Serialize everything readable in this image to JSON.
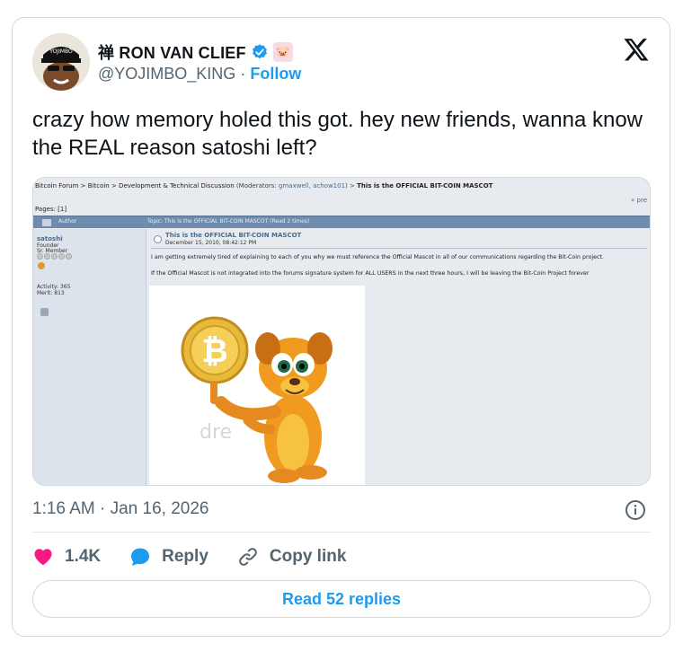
{
  "header": {
    "display_name": "禅 RON VAN CLIEF",
    "emoji_badge": "🐷",
    "handle": "@YOJIMBO_KING",
    "separator": "·",
    "follow_label": "Follow",
    "avatar_cap_text": "YOJIMBO"
  },
  "tweet": {
    "text": "crazy how memory holed this got. hey new friends, wanna know the REAL reason satoshi left?"
  },
  "media": {
    "breadcrumb": "Bitcoin Forum > Bitcoin > Development & Technical Discussion",
    "moderators_label": "(Moderators: ",
    "moderators": "gmaxwell, achow101",
    "moderators_end": ") > ",
    "topic_bold": "This is the OFFICIAL BIT-COIN MASCOT",
    "prev": "« pre",
    "pages": "Pages: [1]",
    "author_header": "Author",
    "topic_header": "Topic: This is the OFFICIAL BIT-COIN MASCOT  (Read 2 times)",
    "username": "satoshi",
    "rank1": "Founder",
    "rank2": "Sr. Member",
    "activity": "Activity: 365",
    "merit": "Merit: 813",
    "post_title": "This is the OFFICIAL BIT-COIN MASCOT",
    "post_date": "December 15, 2010, 08:42:12 PM",
    "body1": "I am getting extremely tired of explaining to each of you why we must reference the Official Mascot in all of our communications regarding the Bit-Coin project.",
    "body2": "If the Official Mascot is not integrated into the forums signature system for ALL USERS in the next three hours, I will be leaving the Bit-Coin Project forever",
    "watermark": "dre"
  },
  "timestamp": "1:16 AM · Jan 16, 2026",
  "actions": {
    "likes": "1.4K",
    "reply": "Reply",
    "copy_link": "Copy link"
  },
  "read_replies": "Read 52 replies",
  "colors": {
    "accent": "#1d9bf0",
    "like": "#f91880",
    "muted": "#536471"
  },
  "icons": [
    "verified-badge-icon",
    "x-logo-icon",
    "info-icon",
    "heart-icon",
    "reply-bubble-icon",
    "link-icon"
  ]
}
